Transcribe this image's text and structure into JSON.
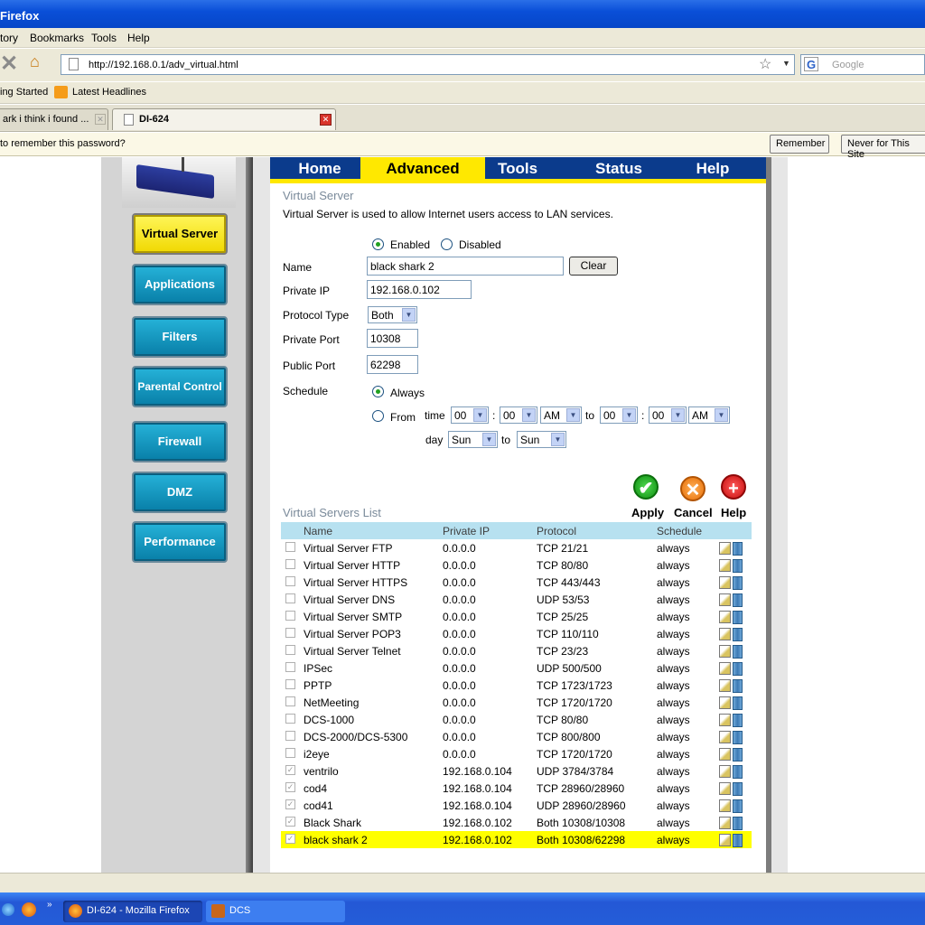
{
  "window": {
    "title": "Firefox"
  },
  "menu": [
    "tory",
    "Bookmarks",
    "Tools",
    "Help"
  ],
  "nav": {
    "url": "http://192.168.0.1/adv_virtual.html",
    "search_placeholder": "Google"
  },
  "bookmarks": [
    "ing Started",
    "Latest Headlines"
  ],
  "tabs": [
    {
      "label": "ark i think i found ..."
    },
    {
      "label": "DI-624"
    }
  ],
  "notification": {
    "text": "to remember this password?",
    "remember": "Remember",
    "never": "Never for This Site"
  },
  "sidebar": [
    {
      "label": "Virtual Server",
      "active": true
    },
    {
      "label": "Applications"
    },
    {
      "label": "Filters"
    },
    {
      "label": "Parental Control"
    },
    {
      "label": "Firewall"
    },
    {
      "label": "DMZ"
    },
    {
      "label": "Performance"
    }
  ],
  "topnav": [
    "Home",
    "Advanced",
    "Tools",
    "Status",
    "Help"
  ],
  "form": {
    "section_title": "Virtual Server",
    "description": "Virtual Server is used to allow Internet users access to LAN services.",
    "enabled": "Enabled",
    "disabled": "Disabled",
    "name_label": "Name",
    "name_value": "black shark 2",
    "clear": "Clear",
    "private_ip_label": "Private IP",
    "private_ip_value": "192.168.0.102",
    "protocol_label": "Protocol Type",
    "protocol_value": "Both",
    "private_port_label": "Private Port",
    "private_port_value": "10308",
    "public_port_label": "Public Port",
    "public_port_value": "62298",
    "schedule_label": "Schedule",
    "always": "Always",
    "from": "From",
    "time": "time",
    "to": "to",
    "colon": ":",
    "day": "day",
    "hour1": "00",
    "min1": "00",
    "ampm1": "AM",
    "hour2": "00",
    "min2": "00",
    "ampm2": "AM",
    "day1": "Sun",
    "day2": "Sun"
  },
  "actions": {
    "apply": "Apply",
    "cancel": "Cancel",
    "help": "Help"
  },
  "list": {
    "title": "Virtual Servers List",
    "headers": [
      "Name",
      "Private IP",
      "Protocol",
      "Schedule"
    ],
    "rows": [
      {
        "name": "Virtual Server FTP",
        "ip": "0.0.0.0",
        "protocol": "TCP 21/21",
        "schedule": "always",
        "checked": false
      },
      {
        "name": "Virtual Server HTTP",
        "ip": "0.0.0.0",
        "protocol": "TCP 80/80",
        "schedule": "always",
        "checked": false
      },
      {
        "name": "Virtual Server HTTPS",
        "ip": "0.0.0.0",
        "protocol": "TCP 443/443",
        "schedule": "always",
        "checked": false
      },
      {
        "name": "Virtual Server DNS",
        "ip": "0.0.0.0",
        "protocol": "UDP 53/53",
        "schedule": "always",
        "checked": false
      },
      {
        "name": "Virtual Server SMTP",
        "ip": "0.0.0.0",
        "protocol": "TCP 25/25",
        "schedule": "always",
        "checked": false
      },
      {
        "name": "Virtual Server POP3",
        "ip": "0.0.0.0",
        "protocol": "TCP 110/110",
        "schedule": "always",
        "checked": false
      },
      {
        "name": "Virtual Server Telnet",
        "ip": "0.0.0.0",
        "protocol": "TCP 23/23",
        "schedule": "always",
        "checked": false
      },
      {
        "name": "IPSec",
        "ip": "0.0.0.0",
        "protocol": "UDP 500/500",
        "schedule": "always",
        "checked": false
      },
      {
        "name": "PPTP",
        "ip": "0.0.0.0",
        "protocol": "TCP 1723/1723",
        "schedule": "always",
        "checked": false
      },
      {
        "name": "NetMeeting",
        "ip": "0.0.0.0",
        "protocol": "TCP 1720/1720",
        "schedule": "always",
        "checked": false
      },
      {
        "name": "DCS-1000",
        "ip": "0.0.0.0",
        "protocol": "TCP 80/80",
        "schedule": "always",
        "checked": false
      },
      {
        "name": "DCS-2000/DCS-5300",
        "ip": "0.0.0.0",
        "protocol": "TCP 800/800",
        "schedule": "always",
        "checked": false
      },
      {
        "name": "i2eye",
        "ip": "0.0.0.0",
        "protocol": "TCP 1720/1720",
        "schedule": "always",
        "checked": false
      },
      {
        "name": "ventrilo",
        "ip": "192.168.0.104",
        "protocol": "UDP 3784/3784",
        "schedule": "always",
        "checked": true
      },
      {
        "name": "cod4",
        "ip": "192.168.0.104",
        "protocol": "TCP 28960/28960",
        "schedule": "always",
        "checked": true
      },
      {
        "name": "cod41",
        "ip": "192.168.0.104",
        "protocol": "UDP 28960/28960",
        "schedule": "always",
        "checked": true
      },
      {
        "name": "Black Shark",
        "ip": "192.168.0.102",
        "protocol": "Both 10308/10308",
        "schedule": "always",
        "checked": true
      },
      {
        "name": "black shark 2",
        "ip": "192.168.0.102",
        "protocol": "Both 10308/62298",
        "schedule": "always",
        "checked": true,
        "highlight": true
      }
    ]
  },
  "taskbar": {
    "items": [
      "DI-624 - Mozilla Firefox",
      "DCS"
    ]
  },
  "colors": {
    "nav": "#0b3b8c",
    "accent": "#ffe800",
    "highlight": "#ffff00",
    "list_header": "#b7e1f0"
  }
}
